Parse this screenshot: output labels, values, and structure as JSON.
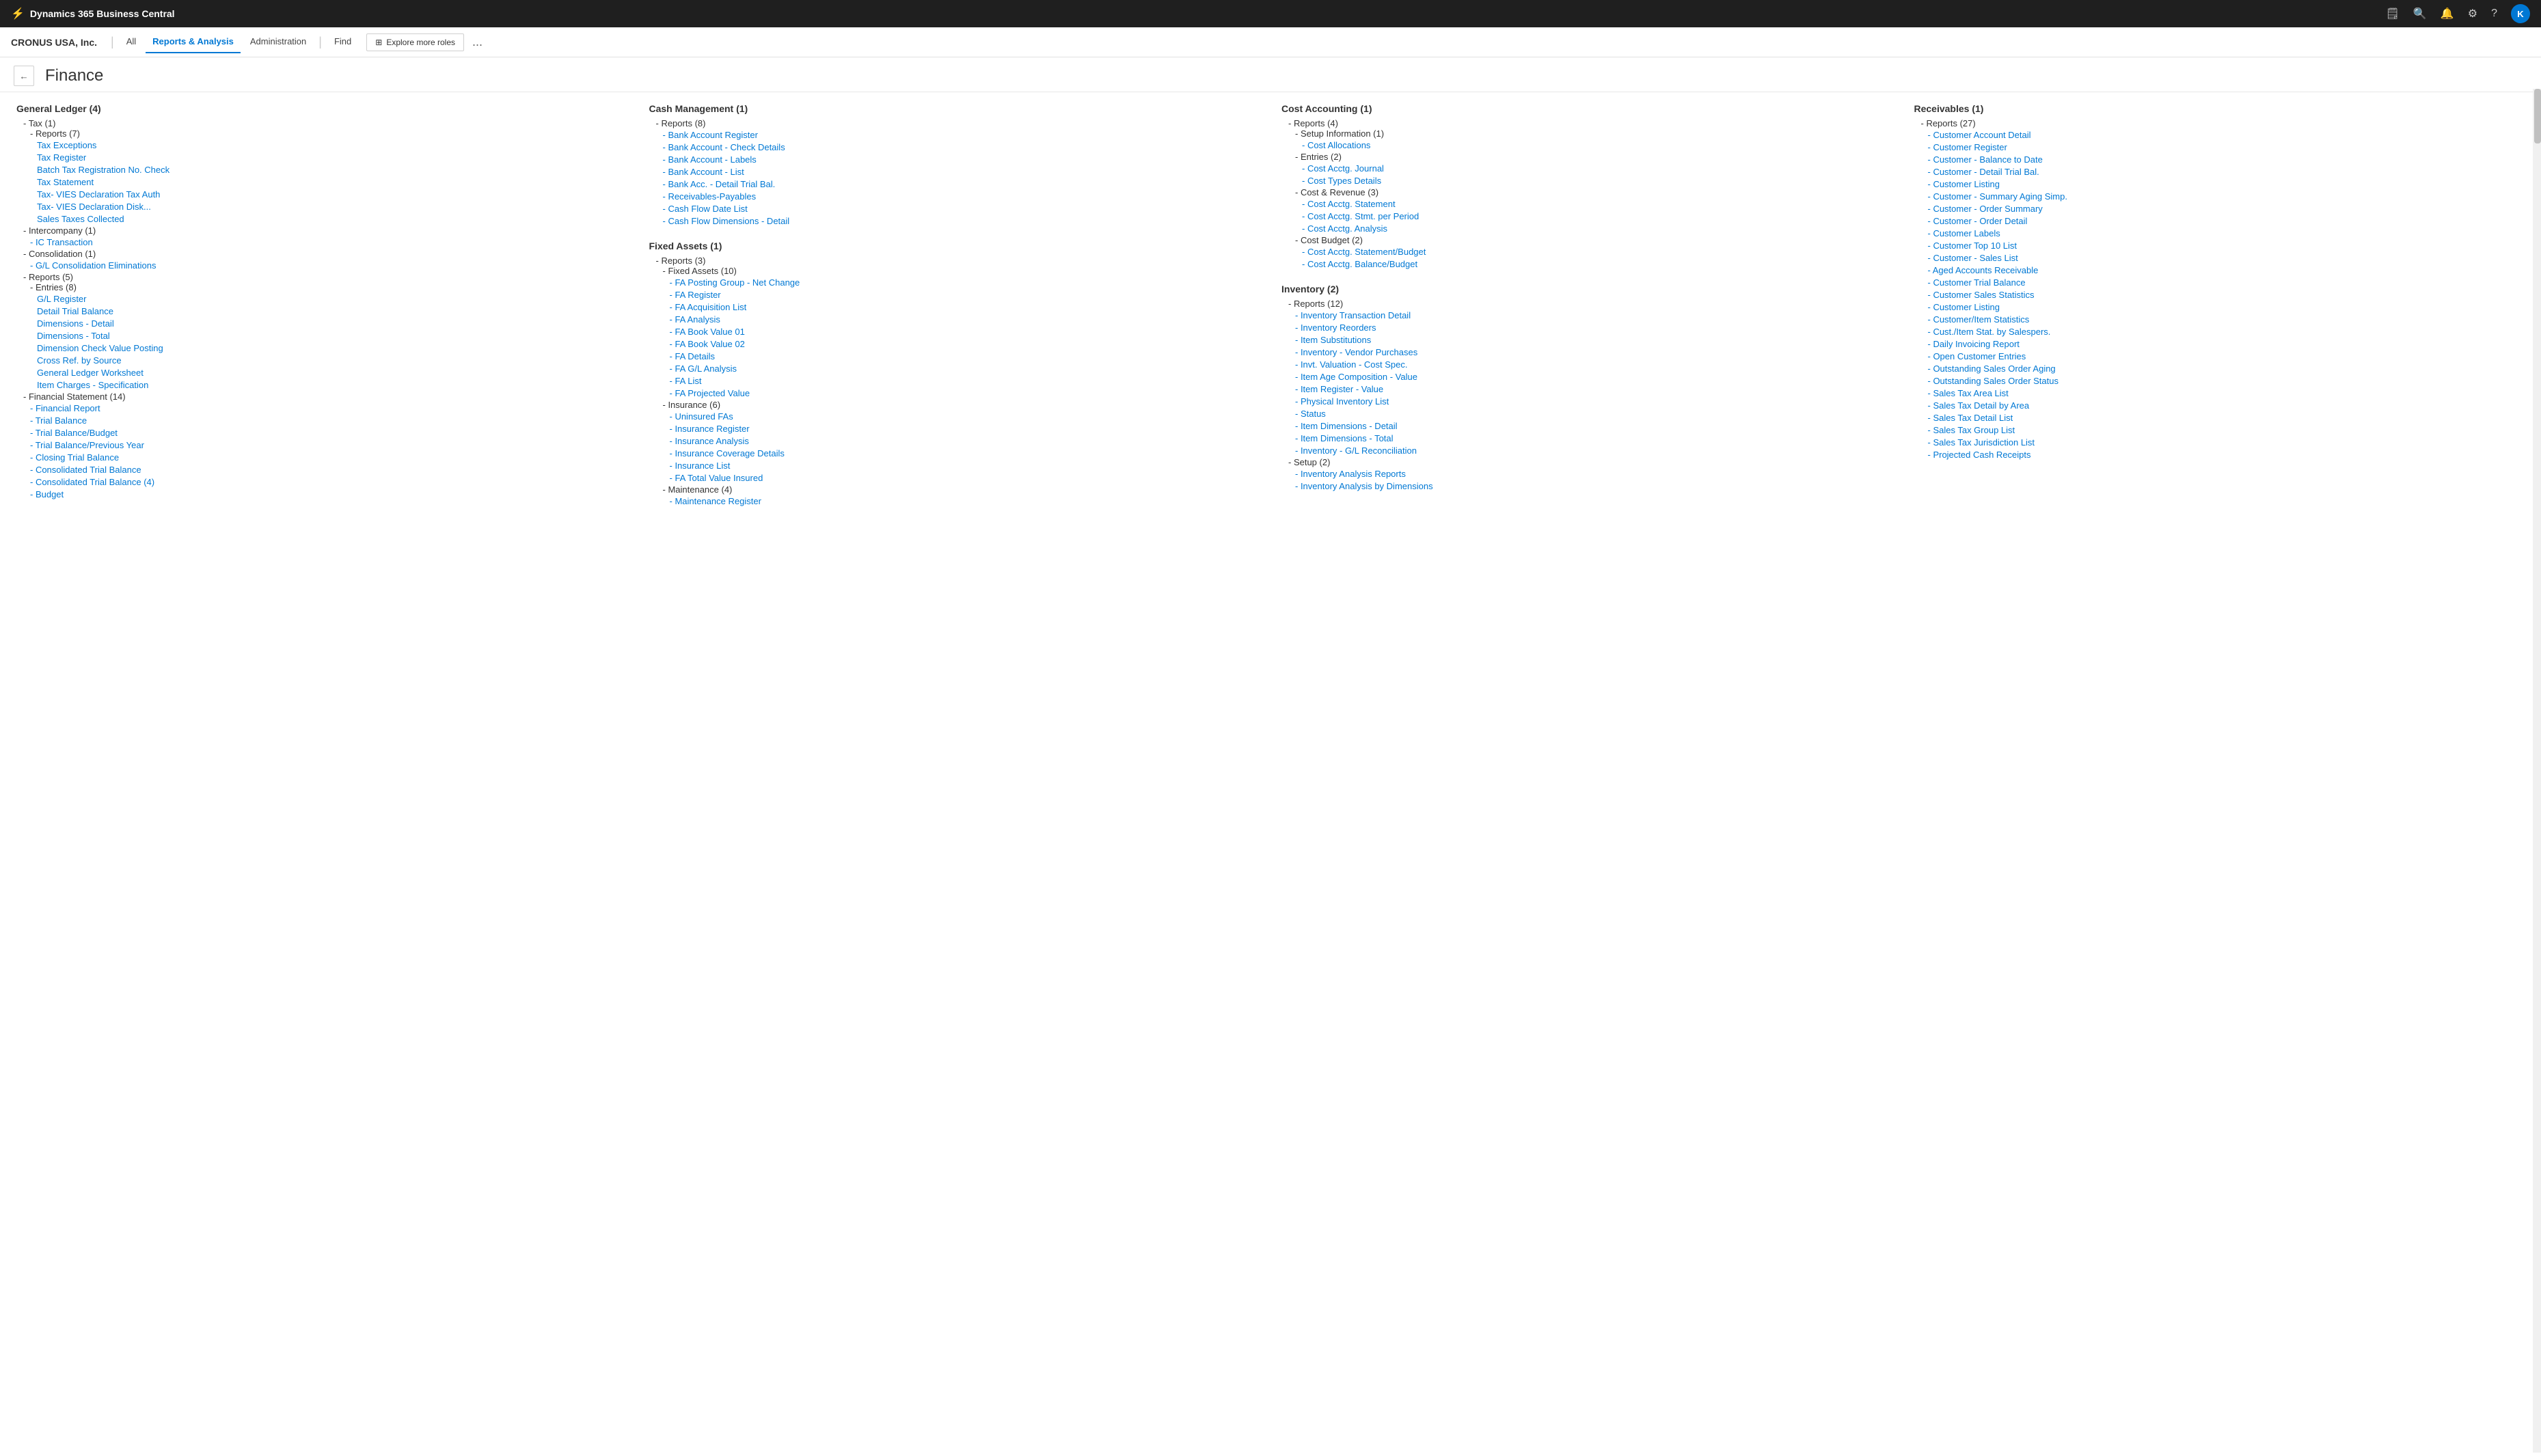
{
  "app": {
    "title": "Dynamics 365 Business Central"
  },
  "company": {
    "name": "CRONUS USA, Inc."
  },
  "nav": {
    "all_label": "All",
    "reports_label": "Reports & Analysis",
    "administration_label": "Administration",
    "find_label": "Find",
    "explore_label": "Explore more roles",
    "more_label": "..."
  },
  "page": {
    "title": "Finance",
    "back_label": "←"
  },
  "user": {
    "avatar_label": "K"
  },
  "columns": {
    "general_ledger": {
      "title": "General Ledger",
      "count": "(4)",
      "sections": [
        {
          "label": "- Tax (1)",
          "subsections": [
            {
              "label": "- Reports (7)",
              "items": [
                "Tax Exceptions",
                "Tax Register",
                "Batch Tax Registration No. Check",
                "Tax Statement",
                "Tax- VIES Declaration Tax Auth",
                "Tax- VIES Declaration Disk...",
                "Sales Taxes Collected"
              ]
            }
          ]
        },
        {
          "label": "- Intercompany (1)",
          "subsections": [
            {
              "label": "",
              "items": [
                "IC Transaction"
              ]
            }
          ]
        },
        {
          "label": "- Consolidation (1)",
          "subsections": [
            {
              "label": "",
              "items": [
                "G/L Consolidation Eliminations"
              ]
            }
          ]
        },
        {
          "label": "- Reports (5)",
          "subsections": [
            {
              "label": "- Entries (8)",
              "items": [
                "G/L Register",
                "Detail Trial Balance",
                "Dimensions - Detail",
                "Dimensions - Total",
                "Dimension Check Value Posting",
                "Cross Ref. by Source",
                "General Ledger Worksheet",
                "Item Charges - Specification"
              ]
            }
          ]
        },
        {
          "label": "- Financial Statement (14)",
          "subsections": [
            {
              "label": "",
              "items": [
                "Financial Report",
                "Trial Balance",
                "Trial Balance/Budget",
                "Trial Balance/Previous Year",
                "Closing Trial Balance",
                "Consolidated Trial Balance",
                "Consolidated Trial Balance (4)",
                "Budget"
              ]
            }
          ]
        }
      ]
    },
    "cash_management": {
      "title": "Cash Management",
      "count": "(1)",
      "sections": [
        {
          "label": "- Reports (8)",
          "subsections": [
            {
              "label": "",
              "items": [
                "Bank Account Register",
                "Bank Account - Check Details",
                "Bank Account - Labels",
                "Bank Account - List",
                "Bank Acc. - Detail Trial Bal.",
                "Receivables-Payables",
                "Cash Flow Date List",
                "Cash Flow Dimensions - Detail"
              ]
            }
          ]
        },
        {
          "label": "Fixed Assets (1)",
          "subsections": [
            {
              "label": "- Reports (3)",
              "items": []
            },
            {
              "label": "- Fixed Assets (10)",
              "items": [
                "FA Posting Group - Net Change",
                "FA Register",
                "FA Acquisition List",
                "FA Analysis",
                "FA Book Value 01",
                "FA Book Value 02",
                "FA Details",
                "FA G/L Analysis",
                "FA List",
                "FA Projected Value"
              ]
            },
            {
              "label": "- Insurance (6)",
              "items": [
                "Uninsured FAs",
                "Insurance Register",
                "Insurance Analysis",
                "Insurance Coverage Details",
                "Insurance List",
                "FA Total Value Insured"
              ]
            },
            {
              "label": "- Maintenance (4)",
              "items": [
                "Maintenance Register"
              ]
            }
          ]
        }
      ]
    },
    "cost_accounting": {
      "title": "Cost Accounting",
      "count": "(1)",
      "sections": [
        {
          "label": "- Reports (4)",
          "subsections": [
            {
              "label": "- Setup Information (1)",
              "items": [
                "Cost Allocations"
              ]
            },
            {
              "label": "- Entries (2)",
              "items": [
                "Cost Acctg. Journal",
                "Cost Types Details"
              ]
            },
            {
              "label": "- Cost & Revenue (3)",
              "items": [
                "Cost Acctg. Statement",
                "Cost Acctg. Stmt. per Period",
                "Cost Acctg. Analysis"
              ]
            },
            {
              "label": "- Cost Budget (2)",
              "items": [
                "Cost Acctg. Statement/Budget",
                "Cost Acctg. Balance/Budget"
              ]
            }
          ]
        },
        {
          "label": "Inventory (2)",
          "subsections": [
            {
              "label": "- Reports (12)",
              "items": [
                "Inventory Transaction Detail",
                "Inventory Reorders",
                "Item Substitutions",
                "Inventory - Vendor Purchases",
                "Invt. Valuation - Cost Spec.",
                "Item Age Composition - Value",
                "Item Register - Value",
                "Physical Inventory List",
                "Status",
                "Item Dimensions - Detail",
                "Item Dimensions - Total",
                "Inventory - G/L Reconciliation"
              ]
            },
            {
              "label": "- Setup (2)",
              "items": [
                "Inventory Analysis Reports",
                "Inventory Analysis by Dimensions"
              ]
            }
          ]
        }
      ]
    },
    "receivables": {
      "title": "Receivables",
      "count": "(1)",
      "sections": [
        {
          "label": "- Reports (27)",
          "subsections": [
            {
              "label": "",
              "items": [
                "Customer Account Detail",
                "Customer Register",
                "Customer - Balance to Date",
                "Customer - Detail Trial Bal.",
                "Customer Listing",
                "Customer - Summary Aging Simp.",
                "Customer - Order Summary",
                "Customer - Order Detail",
                "Customer Labels",
                "Customer Top 10 List",
                "Customer - Sales List",
                "Aged Accounts Receivable",
                "Customer Trial Balance",
                "Customer Sales Statistics",
                "Customer Listing",
                "Customer/Item Statistics",
                "Cust./Item Stat. by Salespers.",
                "Daily Invoicing Report",
                "Open Customer Entries",
                "Outstanding Sales Order Aging",
                "Outstanding Sales Order Status",
                "Sales Tax Area List",
                "Sales Tax Detail by Area",
                "Sales Tax Detail List",
                "Sales Tax Group List",
                "Sales Tax Jurisdiction List",
                "Projected Cash Receipts"
              ]
            }
          ]
        }
      ]
    }
  }
}
